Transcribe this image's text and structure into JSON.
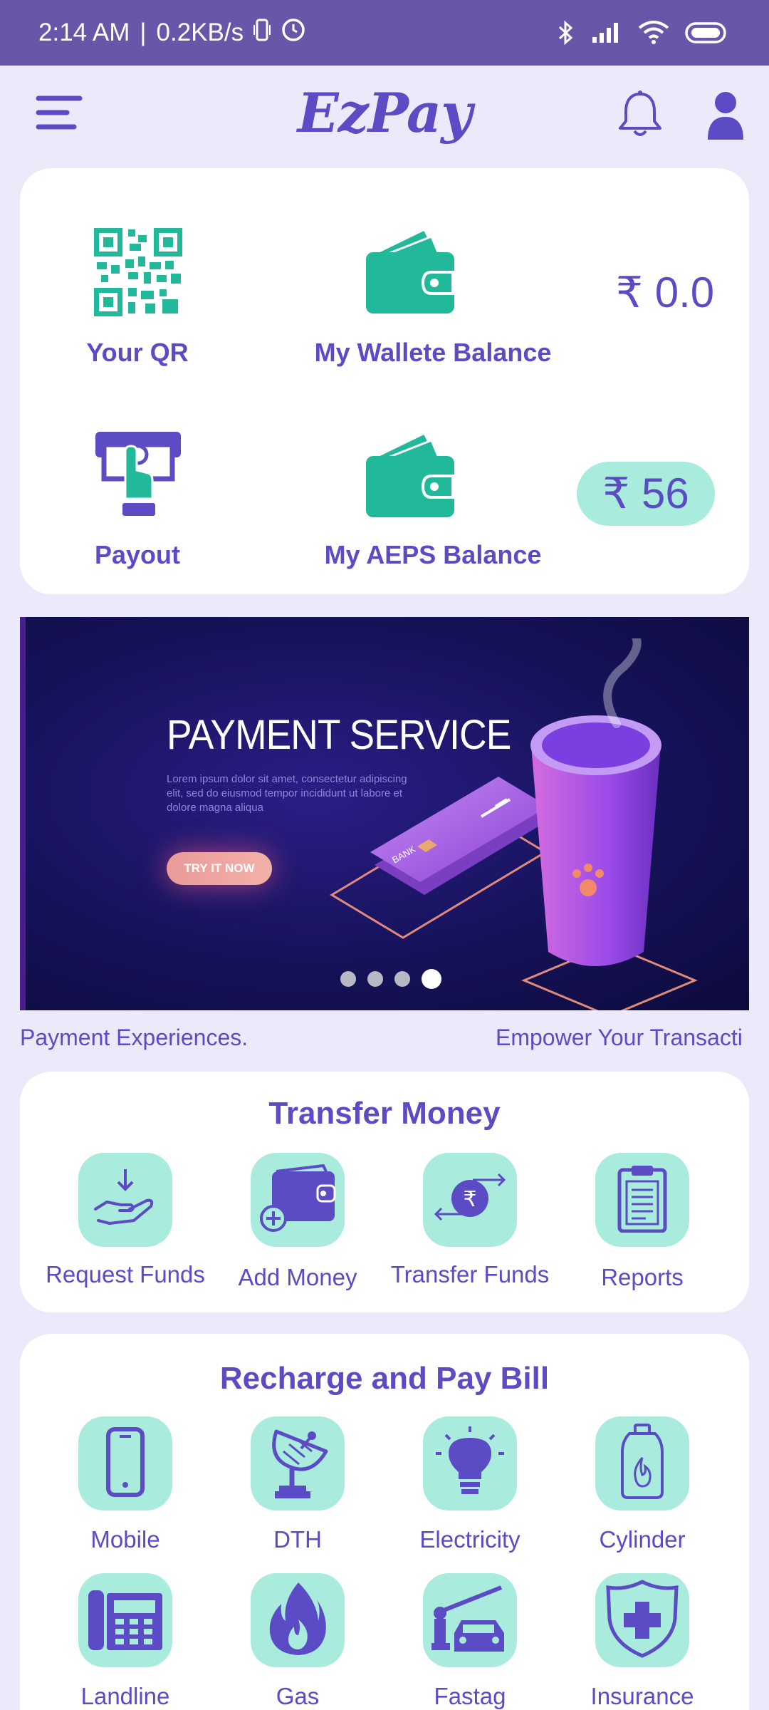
{
  "status_bar": {
    "time": "2:14 AM",
    "speed": "0.2KB/s",
    "separator": "|"
  },
  "header": {
    "brand": "EzPay",
    "icons": [
      "menu-icon",
      "bell-icon",
      "user-icon"
    ]
  },
  "balances": {
    "qr_label": "Your QR",
    "wallet_label": "My Wallete Balance",
    "wallet_amount": "₹ 0.0",
    "payout_label": "Payout",
    "aeps_label": "My AEPS Balance",
    "aeps_amount": "₹ 56"
  },
  "banner": {
    "title": "PAYMENT SERVICE",
    "subtitle": "Lorem ipsum dolor sit amet, consectetur adipiscing elit, sed do eiusmod tempor incididunt ut labore et dolore magna aliqua",
    "cta": "TRY IT NOW",
    "card_text": "BANK",
    "slide_count": 4,
    "active_slide": 4
  },
  "ticker": {
    "items": [
      "Payment Experiences.",
      "Empower Your Transacti"
    ]
  },
  "transfer": {
    "title": "Transfer Money",
    "items": [
      {
        "label": "Request Funds",
        "icon": "hand-receive-icon"
      },
      {
        "label": "Add Money",
        "icon": "wallet-add-icon"
      },
      {
        "label": "Transfer Funds",
        "icon": "rupee-transfer-icon"
      },
      {
        "label": "Reports",
        "icon": "clipboard-icon"
      }
    ]
  },
  "bills": {
    "title": "Recharge and Pay Bill",
    "items": [
      {
        "label": "Mobile",
        "icon": "mobile-icon"
      },
      {
        "label": "DTH",
        "icon": "satellite-dish-icon"
      },
      {
        "label": "Electricity",
        "icon": "bulb-icon"
      },
      {
        "label": "Cylinder",
        "icon": "cylinder-icon"
      },
      {
        "label": "Landline",
        "icon": "landline-icon"
      },
      {
        "label": "Gas",
        "icon": "flame-icon"
      },
      {
        "label": "Fastag",
        "icon": "fastag-icon"
      },
      {
        "label": "Insurance",
        "icon": "insurance-icon"
      }
    ]
  },
  "colors": {
    "accent": "#5B4BC4",
    "teal": "#A9EBDD",
    "green": "#22B89A",
    "background": "#ECE9FB",
    "status_bar": "#6A56A8"
  }
}
